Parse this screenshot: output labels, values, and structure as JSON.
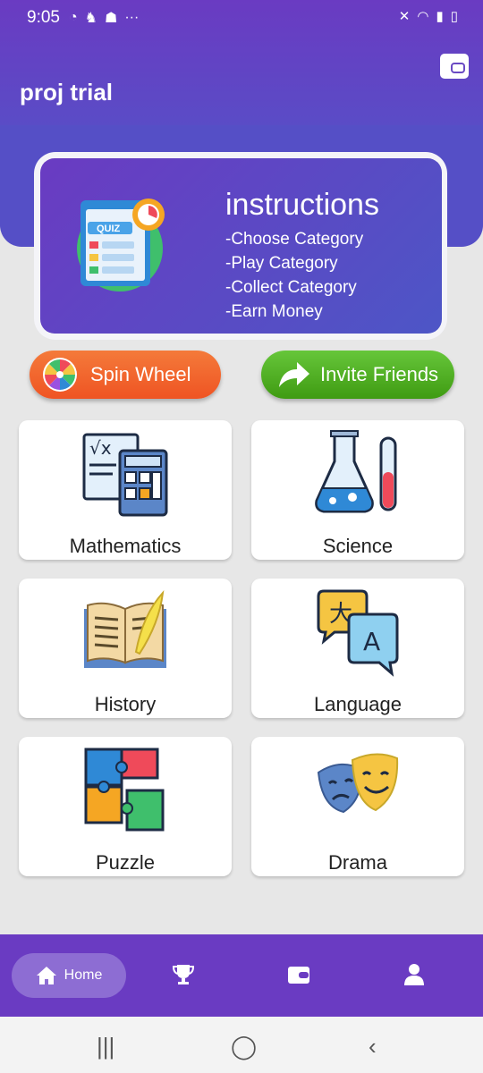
{
  "status_bar": {
    "time": "9:05",
    "dots": "···"
  },
  "app": {
    "title": "proj trial"
  },
  "instructions": {
    "title": "instructions",
    "items": [
      "-Choose Category",
      "-Play Category",
      "-Collect Category",
      "-Earn Money"
    ],
    "art_label": "QUIZ"
  },
  "actions": {
    "spin_label": "Spin Wheel",
    "invite_label": "Invite Friends"
  },
  "categories": [
    {
      "label": "Mathematics",
      "icon": "calculator-icon"
    },
    {
      "label": "Science",
      "icon": "flask-icon"
    },
    {
      "label": "History",
      "icon": "book-quill-icon"
    },
    {
      "label": "Language",
      "icon": "translate-bubbles-icon"
    },
    {
      "label": "Puzzle",
      "icon": "puzzle-icon"
    },
    {
      "label": "Drama",
      "icon": "drama-masks-icon"
    }
  ],
  "bottom_nav": {
    "home_label": "Home",
    "items": [
      "home-icon",
      "trophy-icon",
      "wallet-icon",
      "profile-icon"
    ]
  },
  "colors": {
    "primary": "#6a3bc2",
    "accent": "#4d56c6",
    "spin": "#ef5423",
    "invite": "#3f9b12"
  }
}
